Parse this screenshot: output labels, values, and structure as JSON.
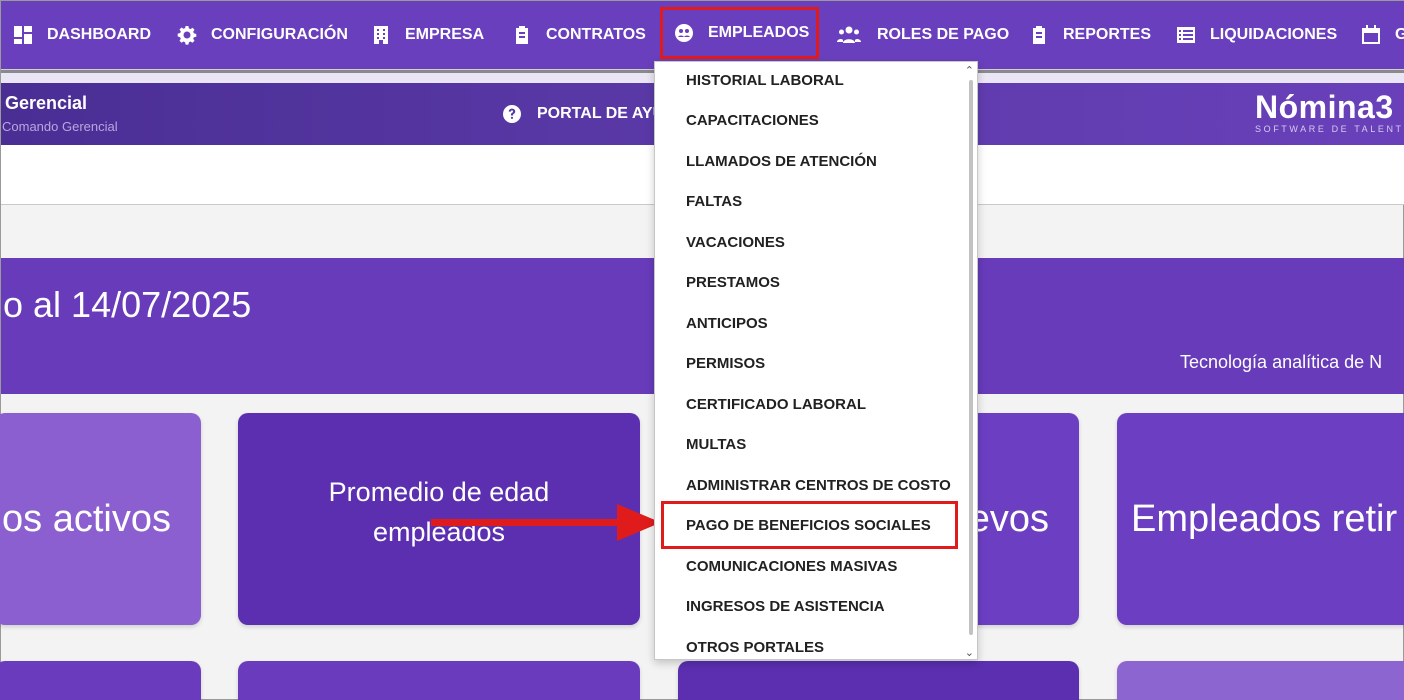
{
  "nav": {
    "items": [
      {
        "label": "DASHBOARD",
        "icon": "dashboard-icon"
      },
      {
        "label": "CONFIGURACIÓN",
        "icon": "gear-icon"
      },
      {
        "label": "EMPRESA",
        "icon": "building-icon"
      },
      {
        "label": "CONTRATOS",
        "icon": "clipboard-icon"
      },
      {
        "label": "EMPLEADOS",
        "icon": "employees-icon"
      },
      {
        "label": "ROLES DE PAGO",
        "icon": "users-icon"
      },
      {
        "label": "REPORTES",
        "icon": "clipboard-icon"
      },
      {
        "label": "LIQUIDACIONES",
        "icon": "list-icon"
      },
      {
        "label": "G",
        "icon": "calendar-icon"
      }
    ],
    "active": "EMPLEADOS"
  },
  "header": {
    "title": "Gerencial",
    "subtitle": "Comando Gerencial",
    "help_label": "PORTAL DE AYUD",
    "brand_name": "Nómina3",
    "brand_tagline": "SOFTWARE DE TALENTO H"
  },
  "banner": {
    "date_text": "o al 14/07/2025",
    "tagline": "Tecnología analítica de N"
  },
  "cards": {
    "c1": "os activos",
    "c2_line1": "Promedio de edad",
    "c2_line2": "empleados",
    "c3": "evos",
    "c4": "Empleados retir"
  },
  "dropdown": {
    "items": [
      "HISTORIAL LABORAL",
      "CAPACITACIONES",
      "LLAMADOS DE ATENCIÓN",
      "FALTAS",
      "VACACIONES",
      "PRESTAMOS",
      "ANTICIPOS",
      "PERMISOS",
      "CERTIFICADO LABORAL",
      "MULTAS",
      "ADMINISTRAR CENTROS DE COSTO",
      "PAGO DE BENEFICIOS SOCIALES",
      "COMUNICACIONES MASIVAS",
      "INGRESOS DE ASISTENCIA",
      "OTROS PORTALES"
    ],
    "highlighted": "PAGO DE BENEFICIOS SOCIALES"
  },
  "colors": {
    "primary": "#6a3fbd",
    "highlight": "#e01b1b"
  }
}
